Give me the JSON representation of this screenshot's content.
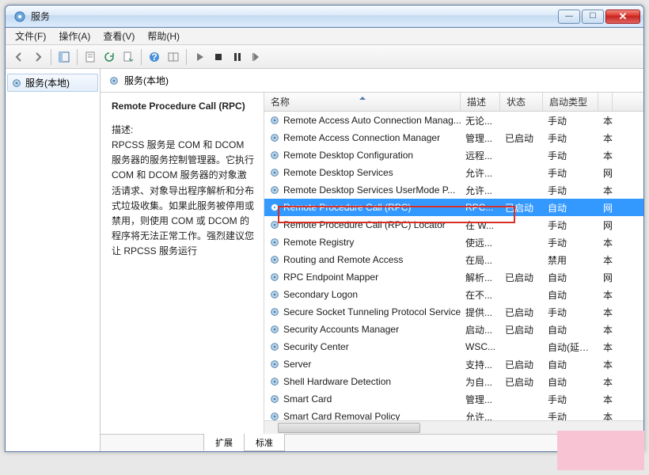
{
  "window": {
    "title": "服务"
  },
  "menu": {
    "file": "文件(F)",
    "action": "操作(A)",
    "view": "查看(V)",
    "help": "帮助(H)"
  },
  "tree": {
    "root": "服务(本地)"
  },
  "panel": {
    "header": "服务(本地)"
  },
  "detail": {
    "title": "Remote Procedure Call (RPC)",
    "desc_label": "描述:",
    "desc": "RPCSS 服务是 COM 和 DCOM 服务器的服务控制管理器。它执行 COM 和 DCOM 服务器的对象激活请求、对象导出程序解析和分布式垃圾收集。如果此服务被停用或禁用，则使用 COM 或 DCOM 的程序将无法正常工作。强烈建议您让 RPCSS 服务运行"
  },
  "columns": {
    "name": "名称",
    "desc": "描述",
    "status": "状态",
    "start": "启动类型"
  },
  "tabs": {
    "ext": "扩展",
    "std": "标准"
  },
  "rows": [
    {
      "name": "Remote Access Auto Connection Manag...",
      "desc": "无论...",
      "status": "",
      "start": "手动",
      "log": "本"
    },
    {
      "name": "Remote Access Connection Manager",
      "desc": "管理...",
      "status": "已启动",
      "start": "手动",
      "log": "本"
    },
    {
      "name": "Remote Desktop Configuration",
      "desc": "远程...",
      "status": "",
      "start": "手动",
      "log": "本"
    },
    {
      "name": "Remote Desktop Services",
      "desc": "允许...",
      "status": "",
      "start": "手动",
      "log": "网"
    },
    {
      "name": "Remote Desktop Services UserMode P...",
      "desc": "允许...",
      "status": "",
      "start": "手动",
      "log": "本"
    },
    {
      "name": "Remote Procedure Call (RPC)",
      "desc": "RPC...",
      "status": "已启动",
      "start": "自动",
      "log": "网",
      "selected": true
    },
    {
      "name": "Remote Procedure Call (RPC) Locator",
      "desc": "在 W...",
      "status": "",
      "start": "手动",
      "log": "网"
    },
    {
      "name": "Remote Registry",
      "desc": "使远...",
      "status": "",
      "start": "手动",
      "log": "本"
    },
    {
      "name": "Routing and Remote Access",
      "desc": "在局...",
      "status": "",
      "start": "禁用",
      "log": "本"
    },
    {
      "name": "RPC Endpoint Mapper",
      "desc": "解析...",
      "status": "已启动",
      "start": "自动",
      "log": "网"
    },
    {
      "name": "Secondary Logon",
      "desc": "在不...",
      "status": "",
      "start": "自动",
      "log": "本"
    },
    {
      "name": "Secure Socket Tunneling Protocol Service",
      "desc": "提供...",
      "status": "已启动",
      "start": "手动",
      "log": "本"
    },
    {
      "name": "Security Accounts Manager",
      "desc": "启动...",
      "status": "已启动",
      "start": "自动",
      "log": "本"
    },
    {
      "name": "Security Center",
      "desc": "WSC...",
      "status": "",
      "start": "自动(延迟...",
      "log": "本"
    },
    {
      "name": "Server",
      "desc": "支持...",
      "status": "已启动",
      "start": "自动",
      "log": "本"
    },
    {
      "name": "Shell Hardware Detection",
      "desc": "为自...",
      "status": "已启动",
      "start": "自动",
      "log": "本"
    },
    {
      "name": "Smart Card",
      "desc": "管理...",
      "status": "",
      "start": "手动",
      "log": "本"
    },
    {
      "name": "Smart Card Removal Policy",
      "desc": "允许...",
      "status": "",
      "start": "手动",
      "log": "本"
    }
  ]
}
